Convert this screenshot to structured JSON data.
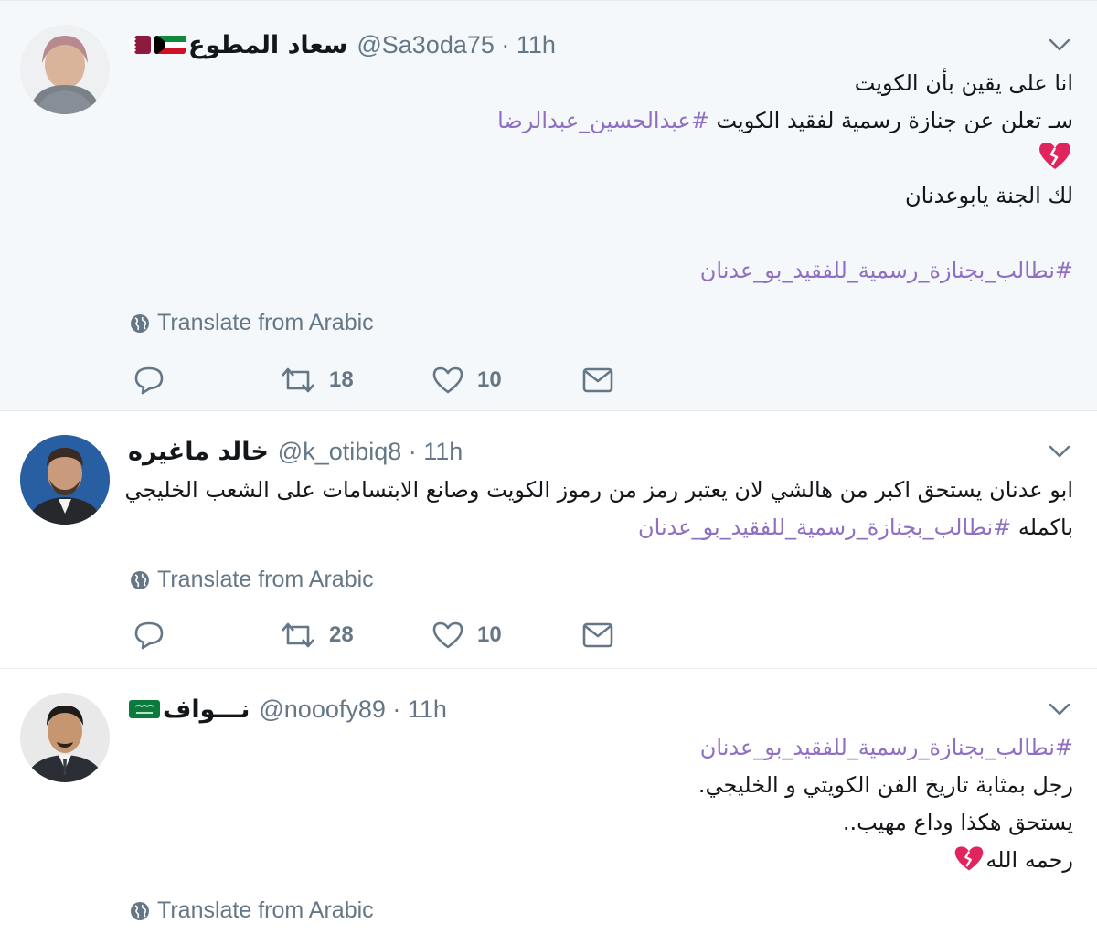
{
  "tweets": [
    {
      "display_name": "سعاد المطوع",
      "meta": "@Sa3oda75 · 11h",
      "flags": [
        "kuwait-flag",
        "qatar-flag"
      ],
      "lines": [
        {
          "text": "انا على يقين بأن الكويت"
        },
        {
          "text": "سـ تعلن عن جنازة رسمية لفقيد الكويت ",
          "hashtag": "#عبدالحسين_عبدالرضا"
        },
        {
          "emoji": "broken-heart"
        },
        {
          "text": "لك الجنة يابوعدنان"
        },
        {
          "text": ""
        },
        {
          "hashtag": "#نطالب_بجنازة_رسمية_للفقيد_بو_عدنان"
        }
      ],
      "translate_label": "Translate from Arabic",
      "reply_icon": "reply-icon",
      "retweet_count": "18",
      "like_count": "10",
      "message_icon": "envelope-icon"
    },
    {
      "display_name": "خالد ماغيره",
      "meta": "@k_otibiq8 · 11h",
      "flags": [],
      "lines": [
        {
          "text": "ابو عدنان يستحق اكبر من هالشي لان يعتبر رمز من رموز الكويت وصانع الابتسامات على الشعب الخليجي"
        },
        {
          "text": "باكمله ",
          "hashtag": "#نطالب_بجنازة_رسمية_للفقيد_بو_عدنان"
        }
      ],
      "translate_label": "Translate from Arabic",
      "reply_icon": "reply-icon",
      "retweet_count": "28",
      "like_count": "10",
      "message_icon": "envelope-icon"
    },
    {
      "display_name": "نـــواف",
      "meta": "@nooofy89 · 11h",
      "flags": [
        "saudi-flag"
      ],
      "lines": [
        {
          "hashtag": "#نطالب_بجنازة_رسمية_للفقيد_بو_عدنان"
        },
        {
          "text": "رجل بمثابة تاريخ الفن الكويتي و الخليجي."
        },
        {
          "text": "يستحق هكذا وداع مهيب.."
        },
        {
          "text": "رحمه الله",
          "emoji": "broken-heart"
        }
      ],
      "translate_label": "Translate from Arabic"
    }
  ],
  "colors": {
    "hashtag": "#8f6fc2",
    "muted": "#657786",
    "highlight_bg": "#f5f8fa",
    "heart_emoji": "#e0245e"
  }
}
